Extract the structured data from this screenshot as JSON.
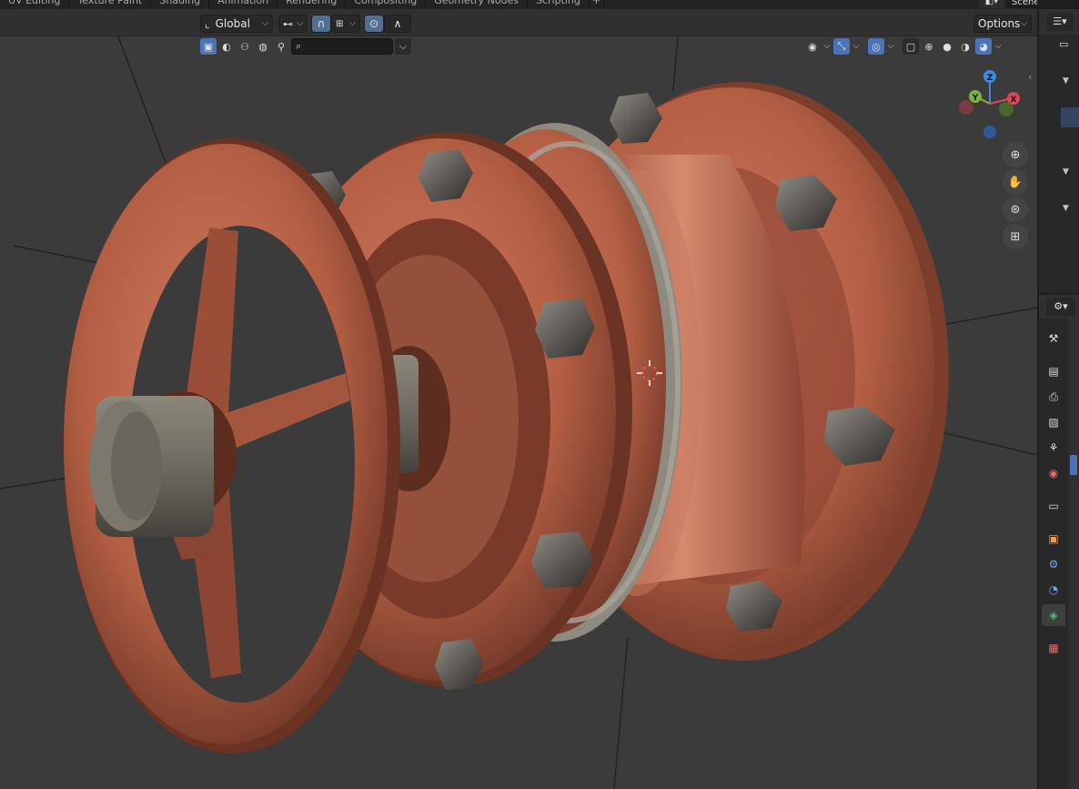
{
  "workspace_tabs": [
    "UV Editing",
    "Texture Paint",
    "Shading",
    "Animation",
    "Rendering",
    "Compositing",
    "Geometry Nodes",
    "Scripting"
  ],
  "workspace_add": "+",
  "scene": {
    "name": "Scene"
  },
  "header": {
    "transform_orientation": "Global",
    "options_label": "Options",
    "chevron": "⌵"
  },
  "viewport": {
    "search_placeholder": "",
    "gizmo": {
      "x": "X",
      "y": "Y",
      "z": "Z",
      "x_color": "#e0445a",
      "y_color": "#7db43c",
      "z_color": "#3d8be0"
    },
    "shading_mode": "material-preview"
  },
  "colors": {
    "accent": "#4a73b8",
    "rust": "#b45f44",
    "metal": "#6f6a60"
  },
  "icons": {
    "transform": "transform-pivot-icon",
    "snap": "magnet-icon",
    "proportional": "proportional-edit-icon",
    "zoom": "magnifier-icon",
    "pan": "hand-icon",
    "camera": "camera-icon",
    "ortho": "grid-icon"
  }
}
